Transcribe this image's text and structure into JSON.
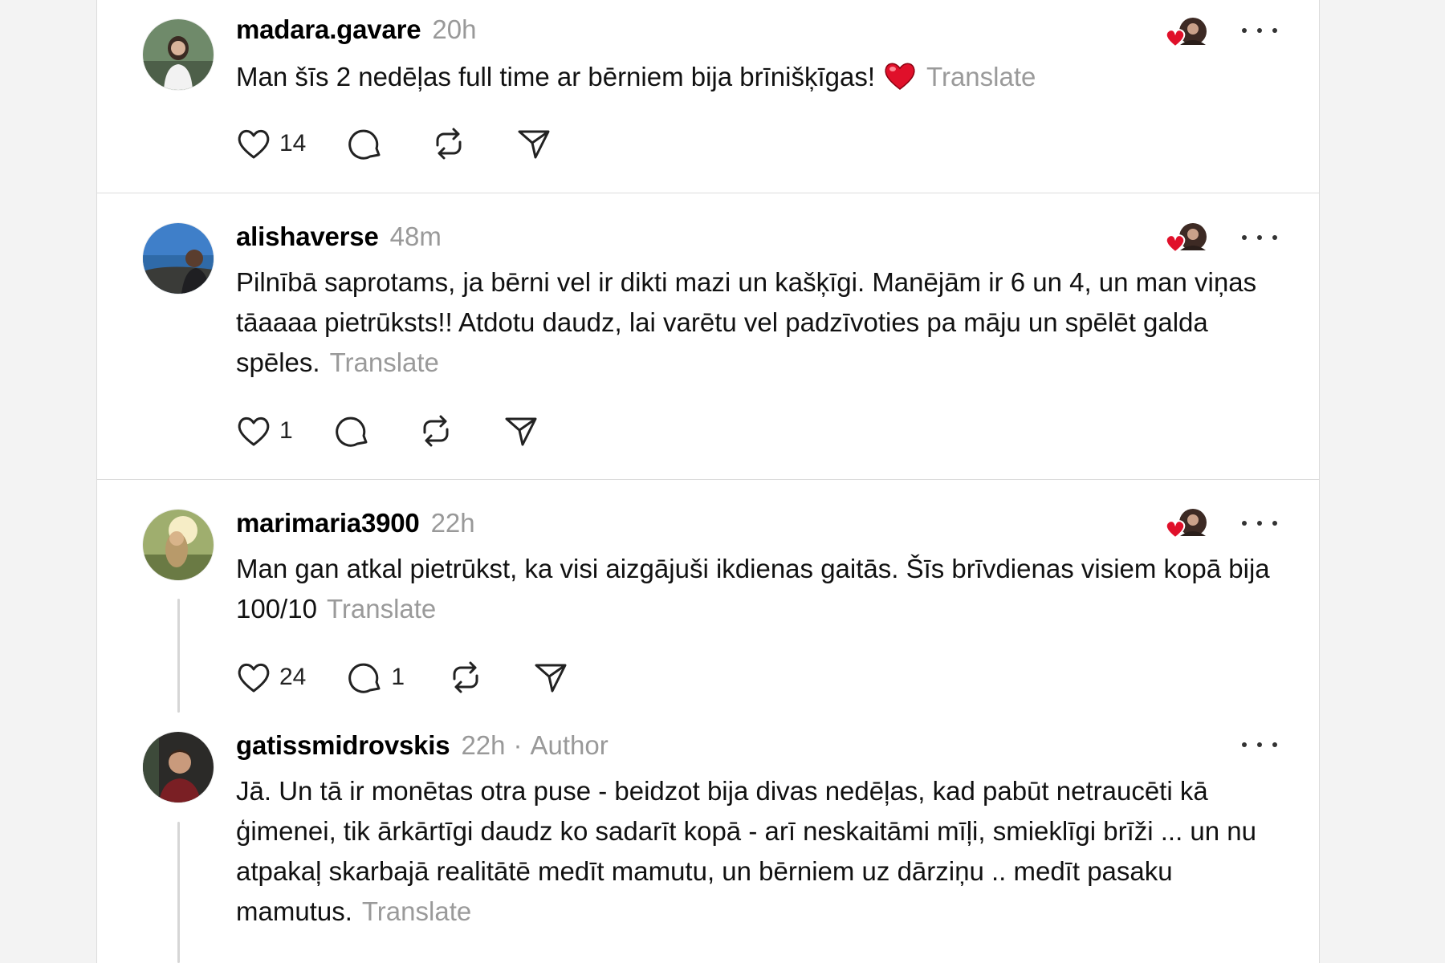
{
  "posts": [
    {
      "username": "madara.gavare",
      "time": "20h",
      "text": "Man šīs 2 nedēļas full time ar bērniem bija brīnišķīgas!",
      "emoji": "❤️",
      "translate": "Translate",
      "likes": "14",
      "replies": "",
      "avatar_icon": "woman-portrait-avatar"
    },
    {
      "username": "alishaverse",
      "time": "48m",
      "text": "Pilnībā saprotams, ja bērni vel ir dikti mazi un kašķīgi. Manējām ir 6 un 4, un man viņas tāaaaa pietrūksts!! Atdotu daudz, lai varētu vel padzīvoties pa māju un spēlēt galda spēles.",
      "translate": "Translate",
      "likes": "1",
      "replies": "",
      "avatar_icon": "sea-landscape-avatar"
    },
    {
      "username": "marimaria3900",
      "time": "22h",
      "text": "Man gan atkal pietrūkst, ka visi aizgājuši ikdienas gaitās. Šīs brīvdienas visiem kopā bija 100/10",
      "translate": "Translate",
      "likes": "24",
      "replies": "1",
      "avatar_icon": "sunset-portrait-avatar"
    },
    {
      "username": "gatissmidrovskis",
      "time": "22h",
      "dot": "·",
      "badge": "Author",
      "text": "Jā. Un tā ir monētas otra puse - beidzot bija divas nedēļas, kad pabūt netraucēti kā ģimenei, tik ārkārtīgi daudz ko sadarīt kopā - arī neskaitāmi mīļi, smieklīgi brīži ... un nu atpakaļ skarbajā realitātē medīt mamutu, un bērniem uz dārziņu .. medīt pasaku mamutus.",
      "translate": "Translate",
      "avatar_icon": "man-portrait-avatar"
    }
  ],
  "colors": {
    "background": "#f3f3f3",
    "card": "#ffffff",
    "muted_text": "#999999",
    "heart_red": "#e0102a"
  }
}
